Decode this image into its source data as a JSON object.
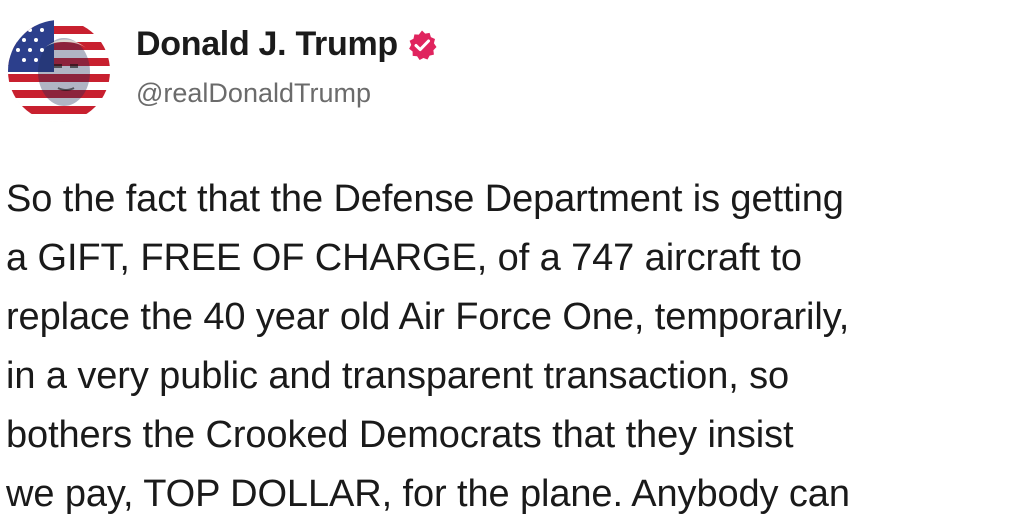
{
  "author": {
    "display_name": "Donald J. Trump",
    "handle": "@realDonaldTrump",
    "avatar": "flag-portrait-avatar",
    "verified_badge": "verified-badge-icon",
    "verified_color": "#e0245e"
  },
  "post": {
    "lines": [
      "So the fact that the Defense Department is getting",
      "a GIFT, FREE OF CHARGE, of a 747 aircraft to",
      "replace the 40 year old Air Force One, temporarily,",
      "in a very public and transparent transaction, so",
      "bothers the Crooked Democrats that they insist",
      "we pay, TOP DOLLAR, for the plane. Anybody can"
    ]
  }
}
